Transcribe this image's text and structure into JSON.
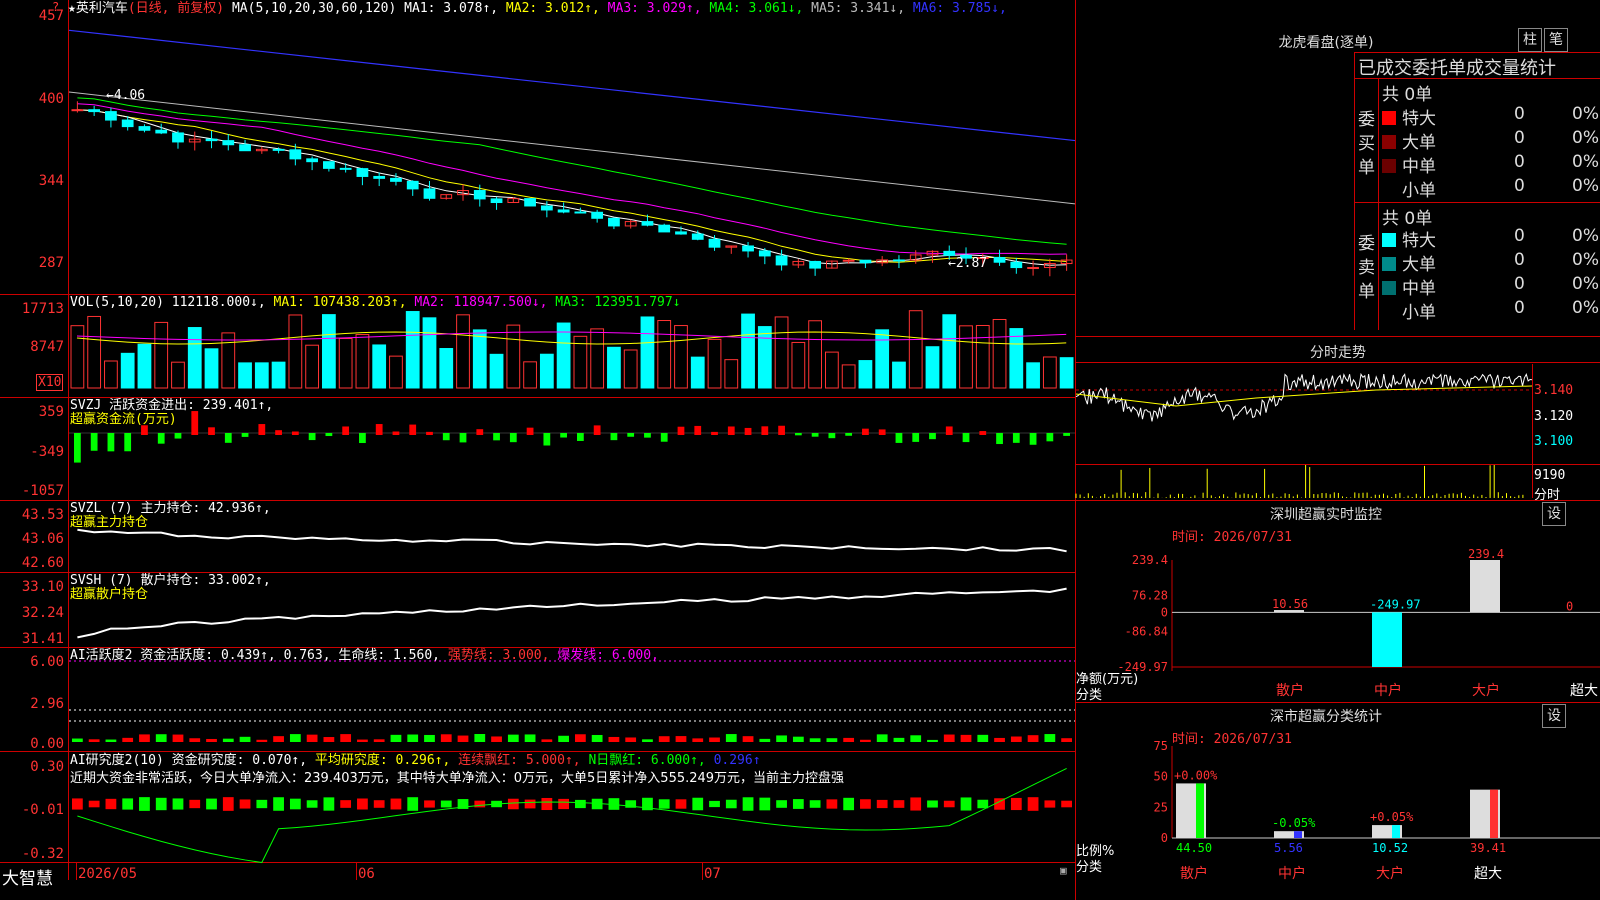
{
  "header": {
    "stock_name": "★英利汽车",
    "period": "(日线, 前复权)",
    "ma_label": "MA(5,10,20,30,60,120)",
    "ma": [
      {
        "name": "MA1:",
        "value": "3.078↑",
        "color": "#ffffff"
      },
      {
        "name": "MA2:",
        "value": "3.012↑",
        "color": "#ffff00"
      },
      {
        "name": "MA3:",
        "value": "3.029↑",
        "color": "#ff00ff"
      },
      {
        "name": "MA4:",
        "value": "3.061↓",
        "color": "#00ff00"
      },
      {
        "name": "MA5:",
        "value": "3.341↓",
        "color": "#bbbbbb"
      },
      {
        "name": "MA6:",
        "value": "3.785↓",
        "color": "#3333ff"
      }
    ]
  },
  "price_pane": {
    "y_labels": [
      "457",
      "400",
      "344",
      "287"
    ],
    "high_label": "←4.06",
    "low_label": "←2.87"
  },
  "vol_pane": {
    "label": "VOL(5,10,20)",
    "value": "112118.000↓,",
    "ma1": "MA1: 107438.203↑,",
    "ma2": "MA2: 118947.500↓,",
    "ma3": "MA3: 123951.797↓",
    "y_labels": [
      "17713",
      "8747"
    ],
    "unit": "X10"
  },
  "svzj_pane": {
    "label": "SVZJ  活跃资金进出: 239.401↑,",
    "sub": "超赢资金流(万元)",
    "y_labels": [
      "359",
      "-349",
      "-1057"
    ]
  },
  "svzl_pane": {
    "label": "SVZL (7) 主力持仓: 42.936↑,",
    "sub": "超赢主力持仓",
    "y_labels": [
      "43.53",
      "43.06",
      "42.60"
    ]
  },
  "svsh_pane": {
    "label": "SVSH (7) 散户持仓: 33.002↑,",
    "sub": "超赢散户持仓",
    "y_labels": [
      "33.10",
      "32.24",
      "31.41"
    ]
  },
  "ai_active_pane": {
    "label1": "AI活跃度2 资金活跃度: 0.439↑, 0.763, 生命线: 1.560,",
    "label2": "强势线: 3.000,",
    "label3": "爆发线: 6.000,",
    "y_labels": [
      "6.00",
      "2.96",
      "0.00"
    ]
  },
  "ai_research_pane": {
    "label1": "AI研究度2(10) 资金研究度: 0.070↑,",
    "label2": "平均研究度: 0.296↑,",
    "label3": "连续飘红: 5.000↑,",
    "label4": "N日飘红: 6.000↑,",
    "label5": "0.296↑",
    "comment": "近期大资金非常活跃，今日大单净流入：239.403万元，其中特大单净流入：0万元，大单5日累计净入555.249万元，当前主力控盘强",
    "y_labels": [
      "0.30",
      "-0.01",
      "-0.32"
    ]
  },
  "footer": {
    "brand": "大智慧",
    "dates": [
      "2026/05",
      "06",
      "07"
    ]
  },
  "dragon": {
    "title": "龙虎看盘(逐单)",
    "btn1": "柱",
    "btn2": "笔",
    "subtitle": "已成交委托单成交量统计",
    "buy_side": "委买单",
    "sell_side": "委卖单",
    "buy_total": "共 0单",
    "sell_total": "共 0单",
    "buy_rows": [
      {
        "label": "特大",
        "count": "0",
        "pct": "0%",
        "color": "#ff0000"
      },
      {
        "label": "大单",
        "count": "0",
        "pct": "0%",
        "color": "#8b0000"
      },
      {
        "label": "中单",
        "count": "0",
        "pct": "0%",
        "color": "#6b0000"
      },
      {
        "label": "小单",
        "count": "0",
        "pct": "0%",
        "color": ""
      }
    ],
    "sell_rows": [
      {
        "label": "特大",
        "count": "0",
        "pct": "0%",
        "color": "#00ffff"
      },
      {
        "label": "大单",
        "count": "0",
        "pct": "0%",
        "color": "#008b8b"
      },
      {
        "label": "中单",
        "count": "0",
        "pct": "0%",
        "color": "#007070"
      },
      {
        "label": "小单",
        "count": "0",
        "pct": "0%",
        "color": ""
      }
    ]
  },
  "intraday": {
    "title": "分时走势",
    "price_labels": [
      "3.140",
      "3.120",
      "3.100"
    ],
    "vol_label": "9190",
    "vol_unit": "分时"
  },
  "monitor": {
    "title": "深圳超赢实时监控",
    "btn": "设",
    "time": "时间: 2026/07/31",
    "y_labels": [
      "239.4",
      "76.28",
      "0",
      "-86.84",
      "-249.97"
    ],
    "ylabel": "净额(万元)",
    "xlabel": "分类",
    "categories": [
      "散户",
      "中户",
      "大户",
      "超大"
    ],
    "bar_labels": [
      "10.56",
      "-249.97",
      "239.4",
      "0"
    ]
  },
  "classify": {
    "title": "深市超赢分类统计",
    "btn": "设",
    "time": "时间: 2026/07/31",
    "y_labels": [
      "75",
      "50",
      "25",
      "0"
    ],
    "ylabel": "比例%",
    "xlabel": "分类",
    "categories": [
      "散户",
      "中户",
      "大户",
      "超大"
    ],
    "values": [
      "44.50",
      "5.56",
      "10.52",
      "39.41"
    ],
    "changes": [
      "+0.00%",
      "-0.05%",
      "+0.05%",
      ""
    ]
  },
  "chart_data": [
    {
      "type": "bar",
      "title": "深圳超赢实时监控",
      "categories": [
        "散户",
        "中户",
        "大户",
        "超大"
      ],
      "values": [
        10.56,
        -249.97,
        239.4,
        0
      ],
      "ylabel": "净额(万元)",
      "ylim": [
        -249.97,
        239.4
      ]
    },
    {
      "type": "bar",
      "title": "深市超赢分类统计",
      "categories": [
        "散户",
        "中户",
        "大户",
        "超大"
      ],
      "values": [
        44.5,
        5.56,
        10.52,
        39.41
      ],
      "ylabel": "比例%",
      "ylim": [
        0,
        75
      ]
    }
  ]
}
